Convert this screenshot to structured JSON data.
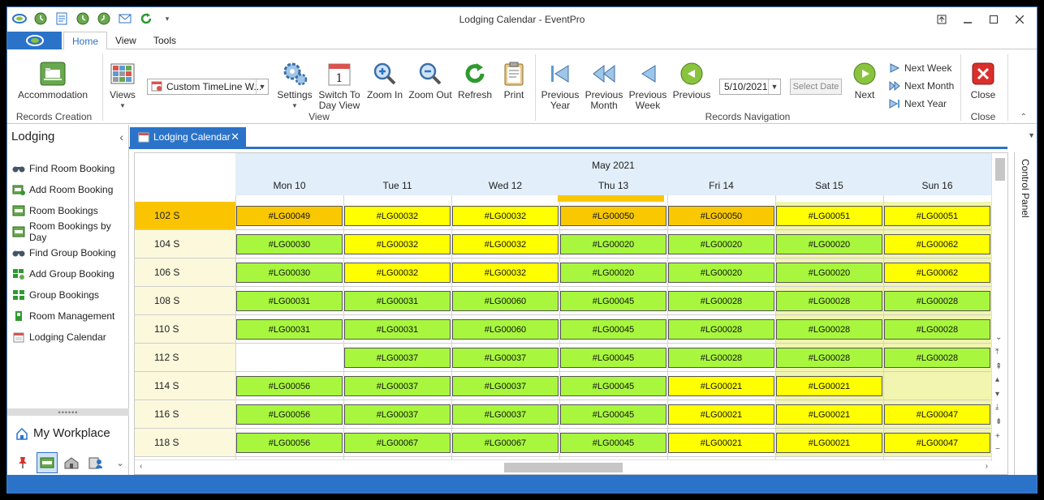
{
  "title": "Lodging Calendar - EventPro",
  "ribbon": {
    "tabs": [
      "Home",
      "View",
      "Tools"
    ],
    "groups": {
      "records_creation": "Records Creation",
      "view": "View",
      "records_navigation": "Records Navigation",
      "close": "Close"
    },
    "accommodation": "Accommodation",
    "views": "Views",
    "view_combo": "Custom TimeLine W...",
    "settings": "Settings",
    "switch_to_day_view_1": "Switch To",
    "switch_to_day_view_2": "Day View",
    "zoom_in": "Zoom In",
    "zoom_out": "Zoom Out",
    "refresh": "Refresh",
    "print": "Print",
    "previous_year_1": "Previous",
    "previous_year_2": "Year",
    "previous_month_1": "Previous",
    "previous_month_2": "Month",
    "previous_week_1": "Previous",
    "previous_week_2": "Week",
    "previous": "Previous",
    "date_value": "5/10/2021",
    "select_date": "Select Date",
    "next": "Next",
    "next_week": "Next Week",
    "next_month": "Next Month",
    "next_year": "Next Year",
    "close": "Close"
  },
  "sidebar": {
    "header": "Lodging",
    "items": [
      {
        "label": "Find Room Booking"
      },
      {
        "label": "Add Room Booking"
      },
      {
        "label": "Room Bookings"
      },
      {
        "label": "Room Bookings by Day"
      },
      {
        "label": "Find Group Booking"
      },
      {
        "label": "Add Group Booking"
      },
      {
        "label": "Group Bookings"
      },
      {
        "label": "Room Management"
      },
      {
        "label": "Lodging Calendar"
      }
    ],
    "grip": "••••••",
    "workplace": "My Workplace"
  },
  "doc_tab": "Lodging Calendar",
  "control_panel": "Control Panel",
  "calendar": {
    "month": "May 2021",
    "days": [
      "Mon 10",
      "Tue 11",
      "Wed 12",
      "Thu 13",
      "Fri 14",
      "Sat 15",
      "Sun 16"
    ],
    "rooms": [
      "102 S",
      "104 S",
      "106 S",
      "108 S",
      "110 S",
      "112 S",
      "114 S",
      "116 S",
      "118 S"
    ],
    "bookings": [
      [
        "#LG00049",
        "#LG00032",
        "#LG00032",
        "#LG00050",
        "#LG00050",
        "#LG00051",
        "#LG00051"
      ],
      [
        "#LG00030",
        "#LG00032",
        "#LG00032",
        "#LG00020",
        "#LG00020",
        "#LG00020",
        "#LG00062"
      ],
      [
        "#LG00030",
        "#LG00032",
        "#LG00032",
        "#LG00020",
        "#LG00020",
        "#LG00020",
        "#LG00062"
      ],
      [
        "#LG00031",
        "#LG00031",
        "#LG00060",
        "#LG00045",
        "#LG00028",
        "#LG00028",
        "#LG00028"
      ],
      [
        "#LG00031",
        "#LG00031",
        "#LG00060",
        "#LG00045",
        "#LG00028",
        "#LG00028",
        "#LG00028"
      ],
      [
        "",
        "#LG00037",
        "#LG00037",
        "#LG00045",
        "#LG00028",
        "#LG00028",
        "#LG00028"
      ],
      [
        "#LG00056",
        "#LG00037",
        "#LG00037",
        "#LG00045",
        "#LG00021",
        "#LG00021",
        ""
      ],
      [
        "#LG00056",
        "#LG00037",
        "#LG00037",
        "#LG00045",
        "#LG00021",
        "#LG00021",
        "#LG00047"
      ],
      [
        "#LG00056",
        "#LG00067",
        "#LG00067",
        "#LG00045",
        "#LG00021",
        "#LG00021",
        "#LG00047"
      ]
    ],
    "colors": [
      [
        "o",
        "y",
        "y",
        "o",
        "o",
        "y",
        "y"
      ],
      [
        "g",
        "y",
        "y",
        "g",
        "g",
        "g",
        "y"
      ],
      [
        "g",
        "y",
        "y",
        "g",
        "g",
        "g",
        "y"
      ],
      [
        "g",
        "g",
        "g",
        "g",
        "g",
        "g",
        "g"
      ],
      [
        "g",
        "g",
        "g",
        "g",
        "g",
        "g",
        "g"
      ],
      [
        "",
        "g",
        "g",
        "g",
        "g",
        "g",
        "g"
      ],
      [
        "g",
        "g",
        "g",
        "g",
        "y",
        "y",
        ""
      ],
      [
        "g",
        "g",
        "g",
        "g",
        "y",
        "y",
        "y"
      ],
      [
        "g",
        "g",
        "g",
        "g",
        "y",
        "y",
        "y"
      ]
    ],
    "palette": {
      "g": "#a8f73e",
      "y": "#ffff00",
      "o": "#f9c800",
      "accent": "#2b73c8"
    }
  }
}
